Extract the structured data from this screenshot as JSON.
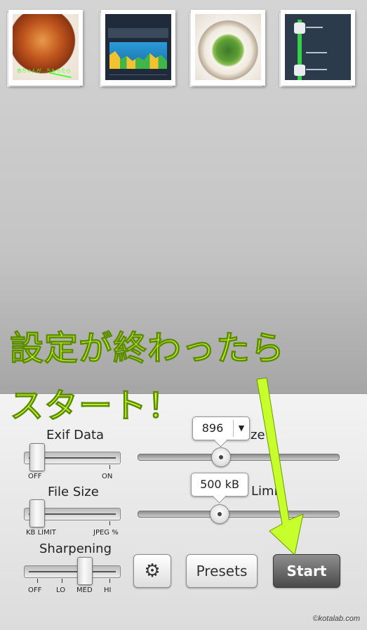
{
  "thumbnails": [
    {
      "name": "pasta-photo",
      "caption": "赤ちゃんが…ちもちたら"
    },
    {
      "name": "sleep-chart-screenshot"
    },
    {
      "name": "food-bowl-photo"
    },
    {
      "name": "transit-route-screenshot"
    }
  ],
  "controls": {
    "exif": {
      "label": "Exif Data",
      "off": "OFF",
      "on": "ON",
      "value": "OFF"
    },
    "file_size": {
      "label": "File Size",
      "left": "KB LIMIT",
      "right": "JPEG %",
      "value": "KB LIMIT"
    },
    "sharpening": {
      "label": "Sharpening",
      "options": [
        "OFF",
        "LO",
        "MED",
        "HI"
      ],
      "value": "MED"
    },
    "image_size": {
      "label_visible": "ize",
      "value": "896",
      "dropdown_icon": "triangle-down-icon"
    },
    "kb_limit": {
      "label_visible": "Limi",
      "value": "500 kB"
    }
  },
  "buttons": {
    "settings_icon": "gear-icon",
    "presets": "Presets",
    "start": "Start"
  },
  "overlay": {
    "line1": "設定が終わったら",
    "line2": "スタート！",
    "color": "#c6ff2c"
  },
  "watermark": "©kotalab.com"
}
